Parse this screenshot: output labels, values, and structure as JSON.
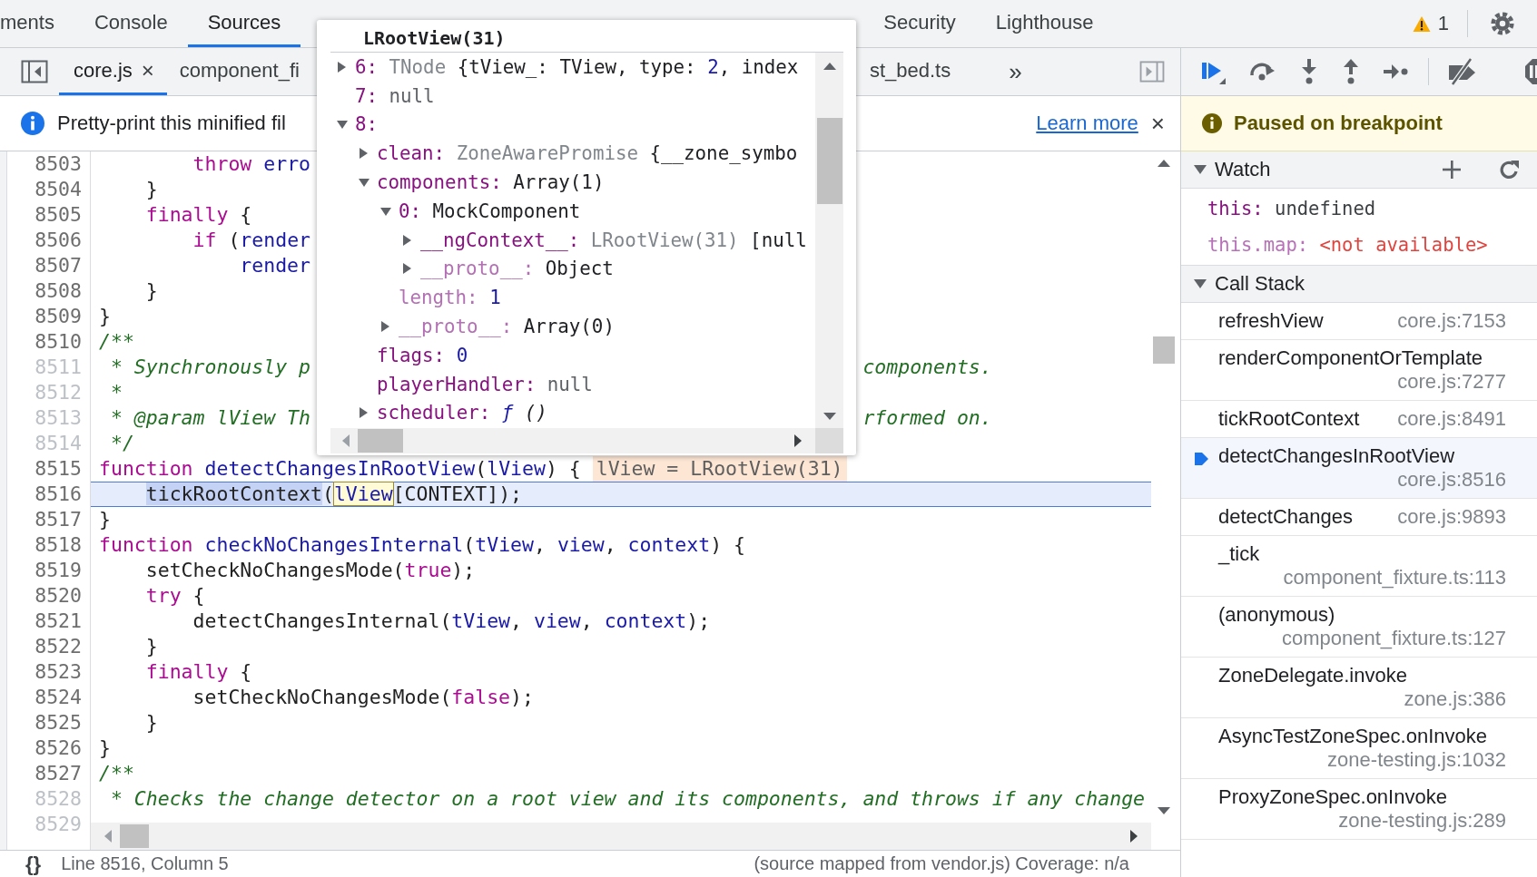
{
  "top_tabs": [
    {
      "label": "ments",
      "selected": false
    },
    {
      "label": "Console",
      "selected": false
    },
    {
      "label": "Sources",
      "selected": true
    },
    {
      "label": "Security",
      "selected": false
    },
    {
      "label": "Lighthouse",
      "selected": false
    }
  ],
  "issues": {
    "count": "1"
  },
  "file_tabs": [
    {
      "label": "core.js",
      "selected": true,
      "close": "×"
    },
    {
      "label": "component_fi",
      "selected": false
    },
    {
      "label": "st_bed.ts",
      "selected": false
    }
  ],
  "more_tabs": "»",
  "infobar": {
    "message": "Pretty-print this minified fil",
    "link": "Learn more",
    "close": "×"
  },
  "editor": {
    "lines": [
      {
        "number": "8503",
        "breakable": true,
        "current": false,
        "tokens": [
          {
            "text": "        throw",
            "kind": "keyword"
          },
          {
            "text": " erro",
            "kind": "variable"
          }
        ]
      },
      {
        "number": "8504",
        "breakable": true,
        "current": false,
        "tokens": [
          {
            "text": "    }",
            "kind": "plain"
          }
        ]
      },
      {
        "number": "8505",
        "breakable": true,
        "current": false,
        "tokens": [
          {
            "text": "    finally",
            "kind": "keyword"
          },
          {
            "text": " {",
            "kind": "plain"
          }
        ]
      },
      {
        "number": "8506",
        "breakable": true,
        "current": false,
        "tokens": [
          {
            "text": "        if",
            "kind": "keyword"
          },
          {
            "text": " (",
            "kind": "plain"
          },
          {
            "text": "render",
            "kind": "variable"
          }
        ]
      },
      {
        "number": "8507",
        "breakable": true,
        "current": false,
        "tokens": [
          {
            "text": "            render",
            "kind": "variable"
          }
        ]
      },
      {
        "number": "8508",
        "breakable": true,
        "current": false,
        "tokens": [
          {
            "text": "    }",
            "kind": "plain"
          }
        ]
      },
      {
        "number": "8509",
        "breakable": true,
        "current": false,
        "tokens": [
          {
            "text": "}",
            "kind": "plain"
          }
        ]
      },
      {
        "number": "8510",
        "breakable": true,
        "current": false,
        "tokens": [
          {
            "text": "/**",
            "kind": "comment"
          }
        ]
      },
      {
        "number": "8511",
        "breakable": false,
        "current": false,
        "tokens": [
          {
            "text": " * Synchronously p",
            "kind": "comment"
          }
        ],
        "tokens_after_popup": [
          {
            "text": "components.",
            "kind": "comment"
          }
        ]
      },
      {
        "number": "8512",
        "breakable": false,
        "current": false,
        "tokens": [
          {
            "text": " *",
            "kind": "comment"
          }
        ]
      },
      {
        "number": "8513",
        "breakable": false,
        "current": false,
        "tokens": [
          {
            "text": " * @param lView Th",
            "kind": "comment"
          }
        ],
        "tokens_after_popup": [
          {
            "text": "rformed on.",
            "kind": "comment"
          }
        ]
      },
      {
        "number": "8514",
        "breakable": false,
        "current": false,
        "tokens": [
          {
            "text": " */",
            "kind": "comment"
          }
        ]
      },
      {
        "number": "8515",
        "breakable": true,
        "current": false,
        "tokens": [
          {
            "text": "function",
            "kind": "keyword"
          },
          {
            "text": " detectChangesInRootView",
            "kind": "variable"
          },
          {
            "text": "(",
            "kind": "plain"
          },
          {
            "text": "lView",
            "kind": "variable"
          },
          {
            "text": ") {",
            "kind": "plain"
          }
        ],
        "inline_value": "lView = LRootView(31)"
      },
      {
        "number": "8516",
        "breakable": true,
        "current": true,
        "tokens": [
          {
            "text": "    tickRootContext",
            "kind": "selection"
          },
          {
            "text": "(",
            "kind": "plain"
          },
          {
            "text": "lView",
            "kind": "hover"
          },
          {
            "text": "[CONTEXT]);",
            "kind": "plain"
          }
        ]
      },
      {
        "number": "8517",
        "breakable": true,
        "current": false,
        "tokens": [
          {
            "text": "}",
            "kind": "plain"
          }
        ]
      },
      {
        "number": "8518",
        "breakable": true,
        "current": false,
        "tokens": [
          {
            "text": "function",
            "kind": "keyword"
          },
          {
            "text": " checkNoChangesInternal",
            "kind": "variable"
          },
          {
            "text": "(",
            "kind": "plain"
          },
          {
            "text": "tView",
            "kind": "variable"
          },
          {
            "text": ", ",
            "kind": "plain"
          },
          {
            "text": "view",
            "kind": "variable"
          },
          {
            "text": ", ",
            "kind": "plain"
          },
          {
            "text": "context",
            "kind": "variable"
          },
          {
            "text": ") {",
            "kind": "plain"
          }
        ]
      },
      {
        "number": "8519",
        "breakable": true,
        "current": false,
        "tokens": [
          {
            "text": "    setCheckNoChangesMode(",
            "kind": "plain"
          },
          {
            "text": "true",
            "kind": "keyword"
          },
          {
            "text": ");",
            "kind": "plain"
          }
        ]
      },
      {
        "number": "8520",
        "breakable": true,
        "current": false,
        "tokens": [
          {
            "text": "    try",
            "kind": "keyword"
          },
          {
            "text": " {",
            "kind": "plain"
          }
        ]
      },
      {
        "number": "8521",
        "breakable": true,
        "current": false,
        "tokens": [
          {
            "text": "        detectChangesInternal(",
            "kind": "plain"
          },
          {
            "text": "tView",
            "kind": "variable"
          },
          {
            "text": ", ",
            "kind": "plain"
          },
          {
            "text": "view",
            "kind": "variable"
          },
          {
            "text": ", ",
            "kind": "plain"
          },
          {
            "text": "context",
            "kind": "variable"
          },
          {
            "text": ");",
            "kind": "plain"
          }
        ]
      },
      {
        "number": "8522",
        "breakable": true,
        "current": false,
        "tokens": [
          {
            "text": "    }",
            "kind": "plain"
          }
        ]
      },
      {
        "number": "8523",
        "breakable": true,
        "current": false,
        "tokens": [
          {
            "text": "    finally",
            "kind": "keyword"
          },
          {
            "text": " {",
            "kind": "plain"
          }
        ]
      },
      {
        "number": "8524",
        "breakable": true,
        "current": false,
        "tokens": [
          {
            "text": "        setCheckNoChangesMode(",
            "kind": "plain"
          },
          {
            "text": "false",
            "kind": "keyword"
          },
          {
            "text": ");",
            "kind": "plain"
          }
        ]
      },
      {
        "number": "8525",
        "breakable": true,
        "current": false,
        "tokens": [
          {
            "text": "    }",
            "kind": "plain"
          }
        ]
      },
      {
        "number": "8526",
        "breakable": true,
        "current": false,
        "tokens": [
          {
            "text": "}",
            "kind": "plain"
          }
        ]
      },
      {
        "number": "8527",
        "breakable": true,
        "current": false,
        "tokens": [
          {
            "text": "/**",
            "kind": "comment"
          }
        ]
      },
      {
        "number": "8528",
        "breakable": false,
        "current": false,
        "tokens": [
          {
            "text": " * Checks the change detector on a root view and its components, and throws if any change",
            "kind": "comment"
          }
        ]
      },
      {
        "number": "8529",
        "breakable": false,
        "current": false
      }
    ]
  },
  "status_bar": {
    "format_button": "{}",
    "position": "Line 8516, Column 5",
    "source_map": "(source mapped from vendor.js) Coverage: n/a"
  },
  "popover": {
    "title": "LRootView(31)",
    "tree": [
      {
        "key": "6:",
        "internal": false,
        "expanded": false,
        "value": [
          {
            "text": "TNode",
            "kind": "dim"
          },
          {
            "text": " {tView_: TView, type: ",
            "kind": "plain"
          },
          {
            "text": "2",
            "kind": "number"
          },
          {
            "text": ", index",
            "kind": "plain"
          }
        ]
      },
      {
        "key": "7:",
        "internal": false,
        "value": [
          {
            "text": "null",
            "kind": "null"
          }
        ]
      },
      {
        "key": "8:",
        "internal": false,
        "expanded": true,
        "children": [
          {
            "key": "clean:",
            "internal": false,
            "expanded": false,
            "value": [
              {
                "text": "ZoneAwarePromise",
                "kind": "dim"
              },
              {
                "text": " {__zone_symbo",
                "kind": "plain"
              }
            ]
          },
          {
            "key": "components:",
            "internal": false,
            "expanded": true,
            "value": [
              {
                "text": "Array(1)",
                "kind": "plain"
              }
            ],
            "children": [
              {
                "key": "0:",
                "internal": false,
                "expanded": true,
                "value": [
                  {
                    "text": "MockComponent",
                    "kind": "plain"
                  }
                ],
                "children": [
                  {
                    "key": "__ngContext__:",
                    "internal": false,
                    "expanded": false,
                    "value": [
                      {
                        "text": "LRootView(31)",
                        "kind": "dim"
                      },
                      {
                        "text": " [null",
                        "kind": "plain"
                      }
                    ]
                  },
                  {
                    "key": "__proto__:",
                    "internal": true,
                    "expanded": false,
                    "value": [
                      {
                        "text": "Object",
                        "kind": "plain"
                      }
                    ]
                  }
                ]
              },
              {
                "key": "length:",
                "internal": true,
                "value": [
                  {
                    "text": "1",
                    "kind": "number"
                  }
                ]
              },
              {
                "key": "__proto__:",
                "internal": true,
                "expanded": false,
                "value": [
                  {
                    "text": "Array(0)",
                    "kind": "plain"
                  }
                ]
              }
            ]
          },
          {
            "key": "flags:",
            "internal": false,
            "value": [
              {
                "text": "0",
                "kind": "number"
              }
            ]
          },
          {
            "key": "playerHandler:",
            "internal": false,
            "value": [
              {
                "text": "null",
                "kind": "null"
              }
            ]
          },
          {
            "key": "scheduler:",
            "internal": false,
            "expanded": false,
            "value": [
              {
                "text": "ƒ",
                "kind": "func"
              },
              {
                "text": " ()",
                "kind": "call"
              }
            ]
          }
        ]
      }
    ]
  },
  "debugger": {
    "paused_message": "Paused on breakpoint",
    "watch": {
      "title": "Watch",
      "expanded": true,
      "expressions": [
        {
          "name": "this:",
          "value": "undefined",
          "available": true
        },
        {
          "name": "this.map:",
          "value": "<not available>",
          "available": false
        }
      ]
    },
    "call_stack": {
      "title": "Call Stack",
      "expanded": true,
      "frames": [
        {
          "name": "refreshView",
          "location": "core.js:7153",
          "selected": false
        },
        {
          "name": "renderComponentOrTemplate",
          "location": "core.js:7277",
          "selected": false
        },
        {
          "name": "tickRootContext",
          "location": "core.js:8491",
          "selected": false
        },
        {
          "name": "detectChangesInRootView",
          "location": "core.js:8516",
          "selected": true
        },
        {
          "name": "detectChanges",
          "location": "core.js:9893",
          "selected": false
        },
        {
          "name": "_tick",
          "location": "component_fixture.ts:113",
          "selected": false
        },
        {
          "name": "(anonymous)",
          "location": "component_fixture.ts:127",
          "selected": false
        },
        {
          "name": "ZoneDelegate.invoke",
          "location": "zone.js:386",
          "selected": false
        },
        {
          "name": "AsyncTestZoneSpec.onInvoke",
          "location": "zone-testing.js:1032",
          "selected": false
        },
        {
          "name": "ProxyZoneSpec.onInvoke",
          "location": "zone-testing.js:289",
          "selected": false
        }
      ]
    }
  }
}
